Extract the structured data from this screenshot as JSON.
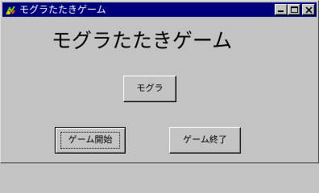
{
  "window": {
    "title": "モグラたたきゲーム",
    "title_bar_color": "#00007b",
    "background_color": "#c3c3c3",
    "icon": "app-icon"
  },
  "title_controls": {
    "minimize_icon": "minimize-icon",
    "maximize_icon": "maximize-icon",
    "close_icon": "close-icon"
  },
  "main": {
    "heading": "モグラたたきゲーム"
  },
  "buttons": {
    "mole_label": "モグラ",
    "start_label": "ゲーム開始",
    "end_label": "ゲーム終了"
  }
}
